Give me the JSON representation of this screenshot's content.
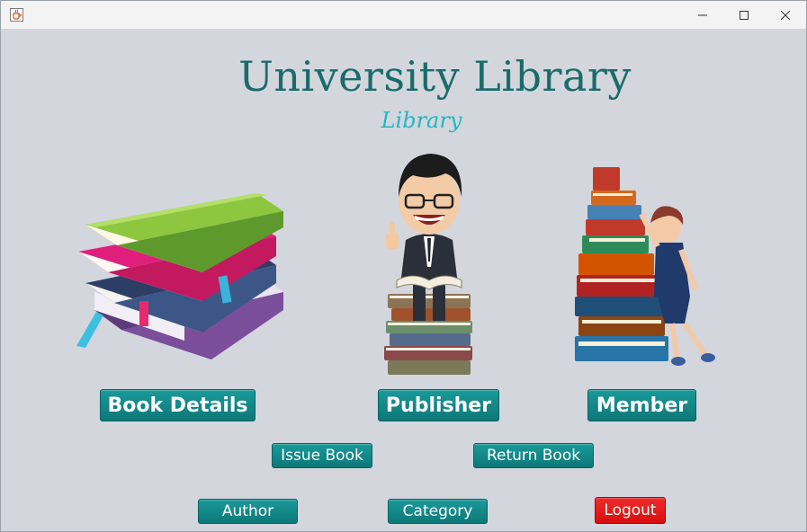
{
  "window": {
    "icon": "java-cup-icon",
    "controls": [
      "minimize-icon",
      "maximize-icon",
      "close-icon"
    ]
  },
  "header": {
    "title": "University Library",
    "subtitle": "Library"
  },
  "illustrations": [
    "book-stack-icon",
    "reader-on-books-icon",
    "child-climbing-books-icon"
  ],
  "main_buttons": {
    "book_details": "Book Details",
    "publisher": "Publisher",
    "member": "Member"
  },
  "actions": {
    "issue_book": "Issue Book",
    "return_book": "Return Book"
  },
  "footer_buttons": {
    "author": "Author",
    "category": "Category",
    "logout": "Logout"
  },
  "colors": {
    "background": "#d3d6dd",
    "title": "#1b6b6b",
    "subtitle": "#20b8c4",
    "button": "#128888",
    "logout": "#e81818"
  }
}
